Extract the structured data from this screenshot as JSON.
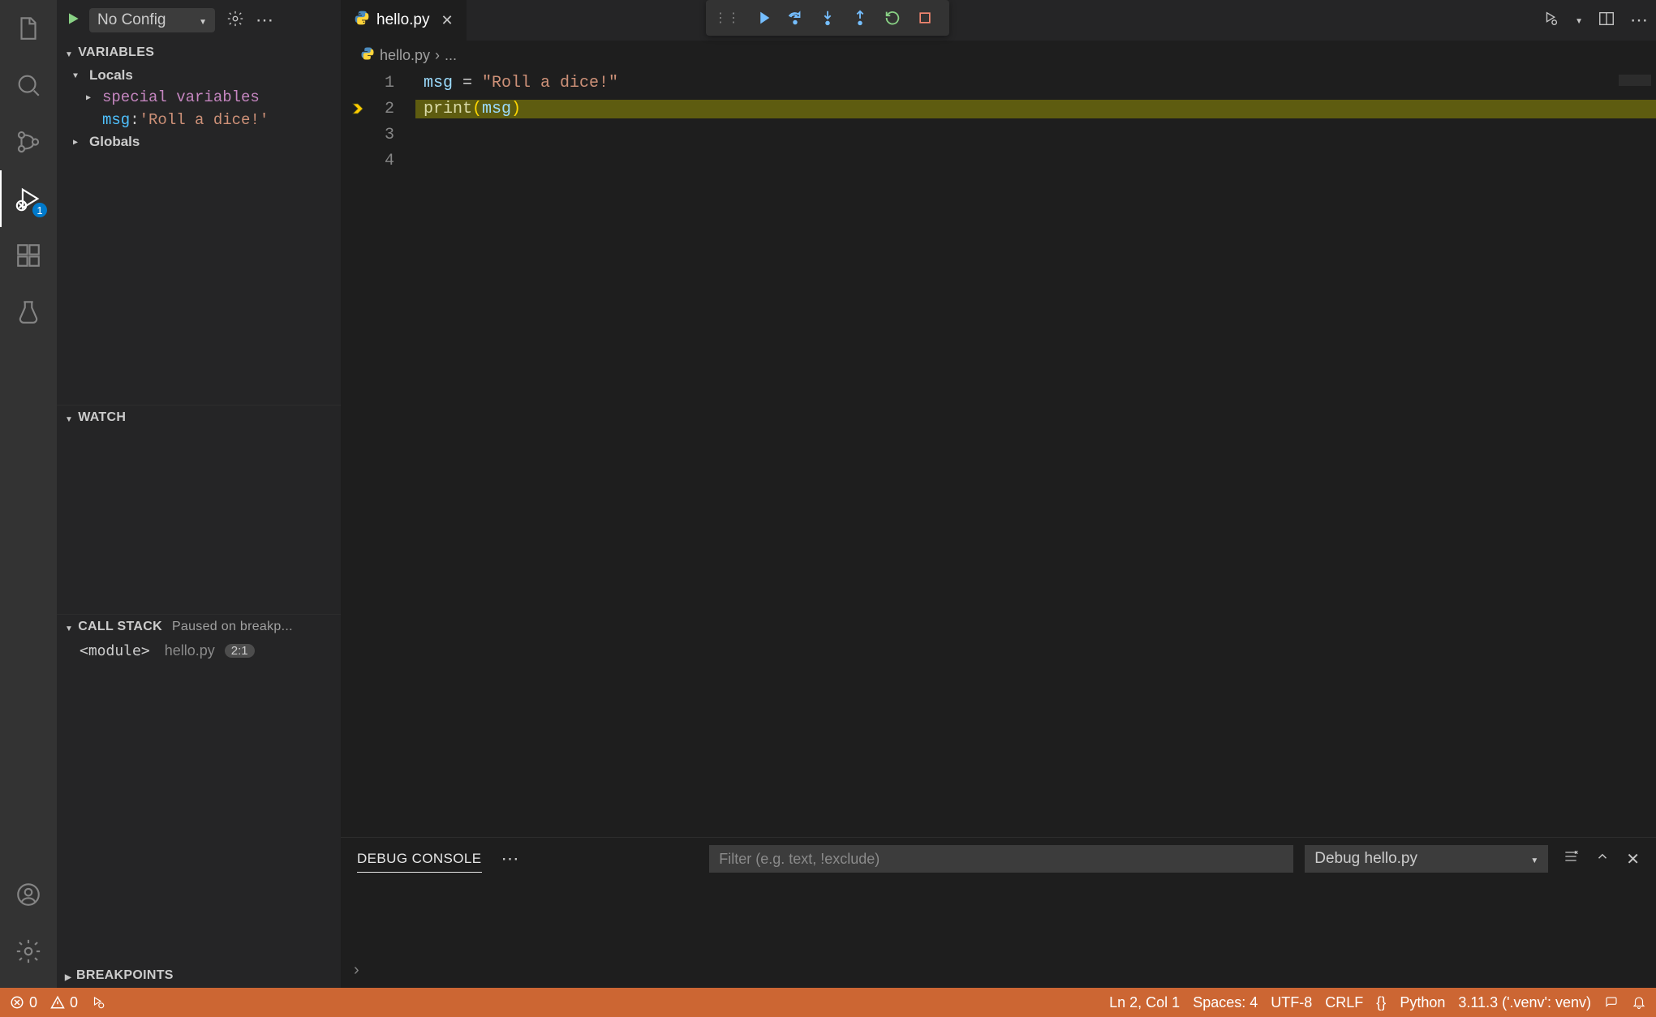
{
  "activityBar": {
    "items": [
      {
        "name": "explorer",
        "active": false
      },
      {
        "name": "search",
        "active": false
      },
      {
        "name": "source-control",
        "active": false
      },
      {
        "name": "run-debug",
        "active": true,
        "badge": "1"
      },
      {
        "name": "extensions",
        "active": false
      },
      {
        "name": "testing",
        "active": false
      }
    ],
    "bottom": [
      {
        "name": "accounts"
      },
      {
        "name": "manage"
      }
    ]
  },
  "debugConfig": {
    "label": "No Config",
    "configureTooltip": "Configure",
    "moreTooltip": "More Actions"
  },
  "variablesSection": {
    "title": "VARIABLES",
    "scopes": [
      {
        "name": "Locals",
        "expanded": true,
        "children": [
          {
            "type": "group",
            "label": "special variables",
            "expanded": false
          },
          {
            "type": "var",
            "name": "msg",
            "value": "'Roll a dice!'"
          }
        ]
      },
      {
        "name": "Globals",
        "expanded": false
      }
    ]
  },
  "watchSection": {
    "title": "WATCH"
  },
  "callStackSection": {
    "title": "CALL STACK",
    "status": "Paused on breakp...",
    "frames": [
      {
        "name": "<module>",
        "file": "hello.py",
        "position": "2:1"
      }
    ]
  },
  "breakpointsSection": {
    "title": "BREAKPOINTS"
  },
  "tabs": [
    {
      "label": "hello.py",
      "icon": "python",
      "active": true
    }
  ],
  "breadcrumb": {
    "file": "hello.py",
    "rest": "..."
  },
  "editor": {
    "lines": [
      {
        "n": "1",
        "tokens": [
          [
            "var",
            "msg"
          ],
          [
            "op",
            " = "
          ],
          [
            "str",
            "\"Roll a dice!\""
          ]
        ],
        "current": false
      },
      {
        "n": "2",
        "tokens": [
          [
            "fn",
            "print"
          ],
          [
            "par",
            "("
          ],
          [
            "arg",
            "msg"
          ],
          [
            "par",
            ")"
          ]
        ],
        "current": true
      },
      {
        "n": "3",
        "tokens": [],
        "current": false
      },
      {
        "n": "4",
        "tokens": [],
        "current": false
      }
    ]
  },
  "debugToolbar": {
    "buttons": [
      "continue",
      "step-over",
      "step-into",
      "step-out",
      "restart",
      "stop"
    ]
  },
  "debugConsole": {
    "tab": "DEBUG CONSOLE",
    "filterPlaceholder": "Filter (e.g. text, !exclude)",
    "target": "Debug hello.py"
  },
  "statusBar": {
    "errors": "0",
    "warnings": "0",
    "cursor": "Ln 2, Col 1",
    "spaces": "Spaces: 4",
    "encoding": "UTF-8",
    "eol": "CRLF",
    "langIcon": "{}",
    "lang": "Python",
    "interpreter": "3.11.3 ('.venv': venv)"
  }
}
